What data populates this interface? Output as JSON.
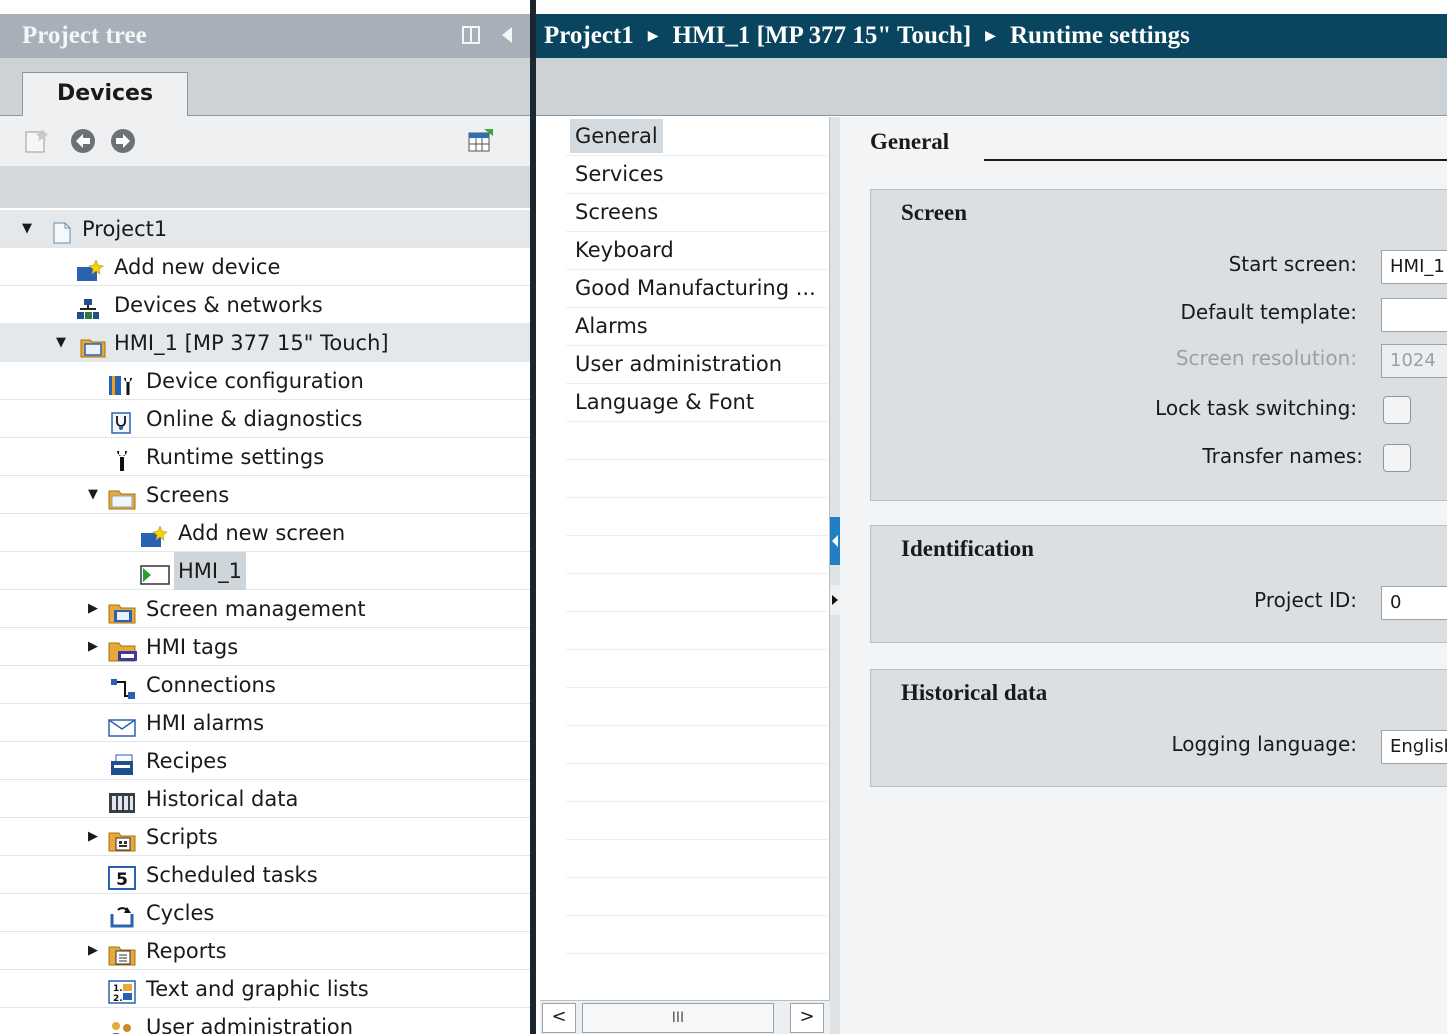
{
  "project_tree": {
    "title": "Project tree",
    "tab_label": "Devices",
    "items": [
      {
        "label": "Project1",
        "arrow": "▼",
        "icon": "project-icon"
      },
      {
        "label": "Add new device",
        "arrow": "",
        "icon": "add-device-icon"
      },
      {
        "label": "Devices & networks",
        "arrow": "",
        "icon": "network-icon"
      },
      {
        "label": "HMI_1 [MP 377 15\" Touch]",
        "arrow": "▼",
        "icon": "hmi-device-icon"
      },
      {
        "label": "Device configuration",
        "arrow": "",
        "icon": "device-config-icon"
      },
      {
        "label": "Online & diagnostics",
        "arrow": "",
        "icon": "diagnostics-icon"
      },
      {
        "label": "Runtime settings",
        "arrow": "",
        "icon": "runtime-settings-icon"
      },
      {
        "label": "Screens",
        "arrow": "▼",
        "icon": "folder-icon"
      },
      {
        "label": "Add new screen",
        "arrow": "",
        "icon": "add-screen-icon"
      },
      {
        "label": "HMI_1",
        "arrow": "",
        "icon": "screen-icon"
      },
      {
        "label": "Screen management",
        "arrow": "▶",
        "icon": "screen-management-folder-icon"
      },
      {
        "label": "HMI tags",
        "arrow": "▶",
        "icon": "tags-folder-icon"
      },
      {
        "label": "Connections",
        "arrow": "",
        "icon": "connections-icon"
      },
      {
        "label": "HMI alarms",
        "arrow": "",
        "icon": "alarms-icon"
      },
      {
        "label": "Recipes",
        "arrow": "",
        "icon": "recipes-icon"
      },
      {
        "label": "Historical data",
        "arrow": "",
        "icon": "historical-data-icon"
      },
      {
        "label": "Scripts",
        "arrow": "▶",
        "icon": "scripts-folder-icon"
      },
      {
        "label": "Scheduled tasks",
        "arrow": "",
        "icon": "scheduled-tasks-icon"
      },
      {
        "label": "Cycles",
        "arrow": "",
        "icon": "cycles-icon"
      },
      {
        "label": "Reports",
        "arrow": "▶",
        "icon": "reports-folder-icon"
      },
      {
        "label": "Text and graphic lists",
        "arrow": "",
        "icon": "text-lists-icon"
      },
      {
        "label": "User administration",
        "arrow": "",
        "icon": "user-admin-icon"
      }
    ]
  },
  "breadcrumb": {
    "parts": [
      "Project1",
      "HMI_1 [MP 377 15\" Touch]",
      "Runtime settings"
    ],
    "separator": "▶"
  },
  "nav": {
    "items": [
      "General",
      "Services",
      "Screens",
      "Keyboard",
      "Good Manufacturing ...",
      "Alarms",
      "User administration",
      "Language & Font"
    ],
    "selected": "General",
    "scroll_left": "<",
    "scroll_right": ">",
    "scroll_thumb": "III"
  },
  "content": {
    "title": "General",
    "sections": {
      "screen": {
        "title": "Screen",
        "start_screen_label": "Start screen:",
        "start_screen_value": "HMI_1",
        "default_template_label": "Default template:",
        "default_template_value": "",
        "screen_resolution_label": "Screen resolution:",
        "screen_resolution_value": "1024",
        "lock_task_label": "Lock task switching:",
        "transfer_names_label": "Transfer names:"
      },
      "identification": {
        "title": "Identification",
        "project_id_label": "Project ID:",
        "project_id_value": "0"
      },
      "historical": {
        "title": "Historical data",
        "logging_language_label": "Logging language:",
        "logging_language_value": "English"
      }
    }
  }
}
